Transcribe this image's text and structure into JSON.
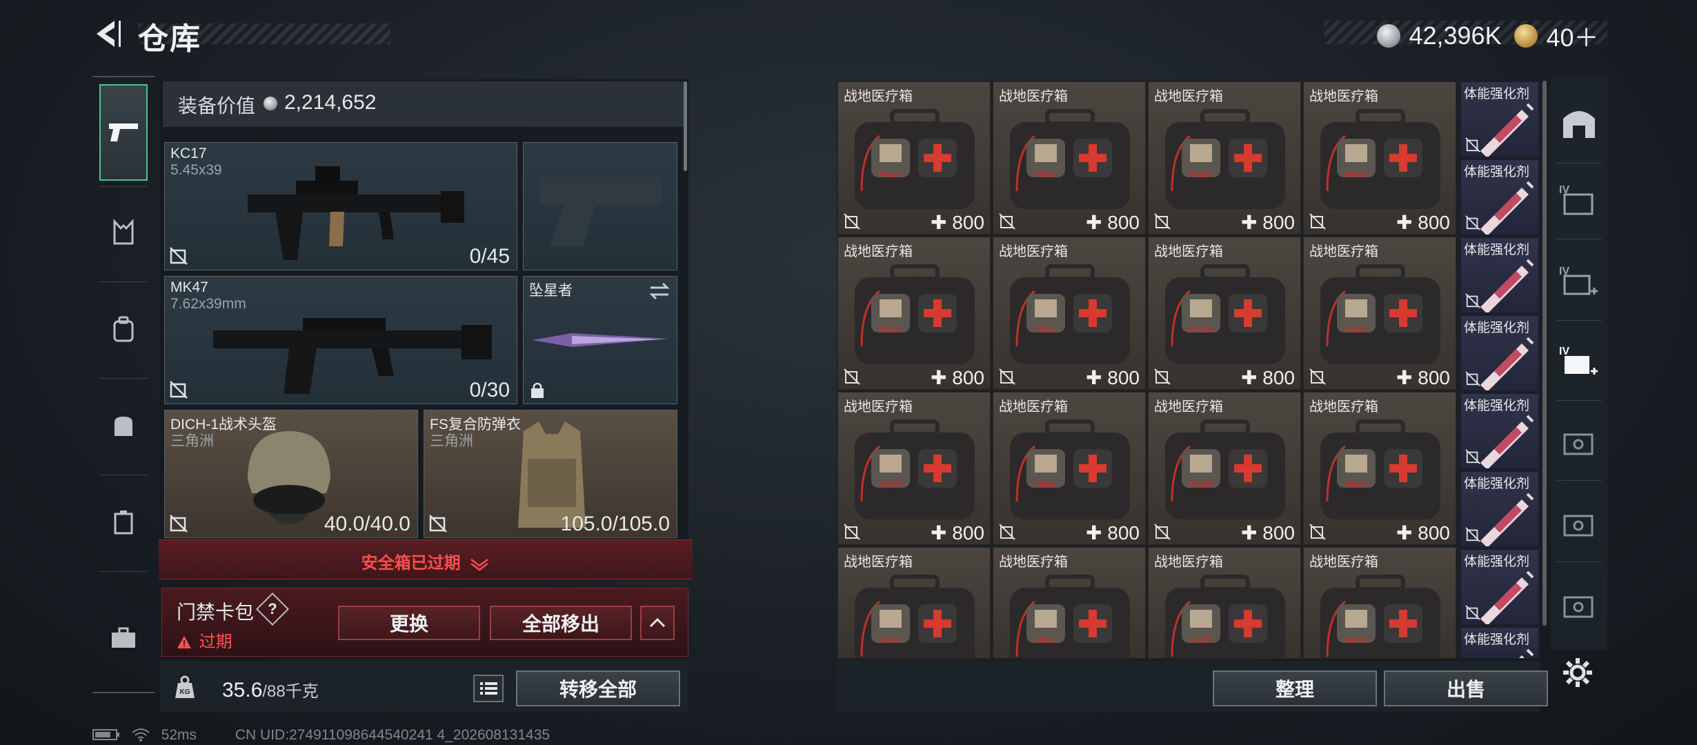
{
  "header": {
    "title": "仓库",
    "back_icon": "back-arrow-icon"
  },
  "currency": {
    "silver": "42,396K",
    "gold": "40＋",
    "silver_color": "#b9bec2",
    "gold_color": "#c9a45a"
  },
  "equipment": {
    "value_label": "装备价值",
    "value": "2,214,652",
    "slots": [
      {
        "name": "KC17",
        "sub": "5.45x39",
        "count": "0/45"
      },
      {
        "name": "",
        "sub": "",
        "count": ""
      },
      {
        "name": "MK47",
        "sub": "7.62x39mm",
        "count": "0/30"
      },
      {
        "name": "坠星者",
        "sub": "",
        "count": ""
      },
      {
        "name": "DICH-1战术头盔",
        "sub": "三角洲",
        "count": "40.0/40.0"
      },
      {
        "name": "FS复合防弹衣",
        "sub": "三角洲",
        "count": "105.0/105.0"
      }
    ]
  },
  "safebox": {
    "status": "安全箱已过期",
    "accent_color": "#ff4d4d"
  },
  "card_pack": {
    "label": "门禁卡包",
    "help": "?",
    "expired": "过期",
    "replace": "更换",
    "remove_all": "全部移出"
  },
  "weight": {
    "current": "35.6",
    "max": "/88千克",
    "transfer_all": "转移全部"
  },
  "stash": {
    "item_name": "战地医疗箱",
    "qty": "800",
    "stim_name": "体能强化剂",
    "tidy": "整理",
    "sell": "出售"
  },
  "status": {
    "ping": "52ms",
    "uid": "CN UID:274911098644540241 4_202608131435"
  }
}
